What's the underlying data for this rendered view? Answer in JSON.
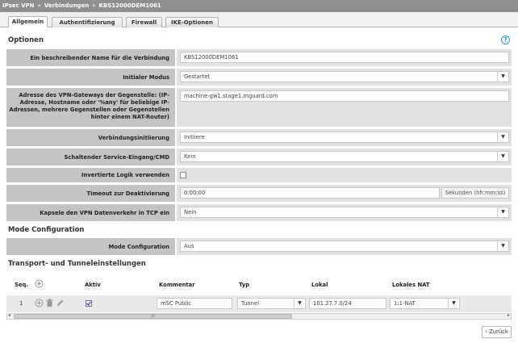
{
  "breadcrumb": [
    "IPsec VPN",
    "Verbindungen",
    "KBS12000DEM1061"
  ],
  "tabs": [
    "Allgemein",
    "Authentifizierung",
    "Firewall",
    "IKE-Optionen"
  ],
  "sections": {
    "options": "Optionen",
    "mode_config": "Mode Configuration",
    "transport": "Transport- und Tunneleinstellungen"
  },
  "help_icon": "?",
  "fields": {
    "name": {
      "label": "Ein beschreibender Name für die Verbindung",
      "value": "KBS12000DEM1061"
    },
    "initial_mode": {
      "label": "Initialer Modus",
      "value": "Gestartet"
    },
    "gateway": {
      "label": "Adresse des VPN-Gateways der Gegenstelle: (IP-Adresse, Hostname oder '%any' für beliebige IP-Adressen, mehrere Gegenstellen oder Gegenstellen hinter einem NAT-Router)",
      "value": "machine-gw1.stage1.mguard.com"
    },
    "initiation": {
      "label": "Verbindungsinitiierung",
      "value": "Initiiere"
    },
    "service_input": {
      "label": "Schaltender Service-Eingang/CMD",
      "value": "Kein"
    },
    "inverted_logic": {
      "label": "Invertierte Logik verwenden",
      "checked": false
    },
    "timeout": {
      "label": "Timeout zur Deaktivierung",
      "value": "0:00:00",
      "suffix": "Sekunden (hh:mm:ss)"
    },
    "tcp_encap": {
      "label": "Kapsele den VPN Datenverkehr in TCP ein",
      "value": "Nein"
    },
    "mode_config": {
      "label": "Mode Configuration",
      "value": "Aus"
    }
  },
  "table": {
    "headers": {
      "seq": "Seq.",
      "active": "Aktiv",
      "comment": "Kommentar",
      "type": "Typ",
      "local": "Lokal",
      "local_nat": "Lokales NAT"
    },
    "rows": [
      {
        "seq": "1",
        "active": true,
        "comment": "mSC Public",
        "type": "Tunnel",
        "local": "101.27.7.0/24",
        "local_nat": "1:1-NAT"
      }
    ]
  },
  "scroll_mark": "III",
  "back_button": "Zurück",
  "icons": {
    "add": "plus-circle-icon",
    "delete": "trash-icon",
    "edit": "pencil-icon",
    "help": "question-circle-icon"
  },
  "colors": {
    "titlebar": "#8f8f8f",
    "label_bg": "#c4c4c4",
    "value_bg": "#e2e2e2",
    "help": "#2a9fd6"
  }
}
